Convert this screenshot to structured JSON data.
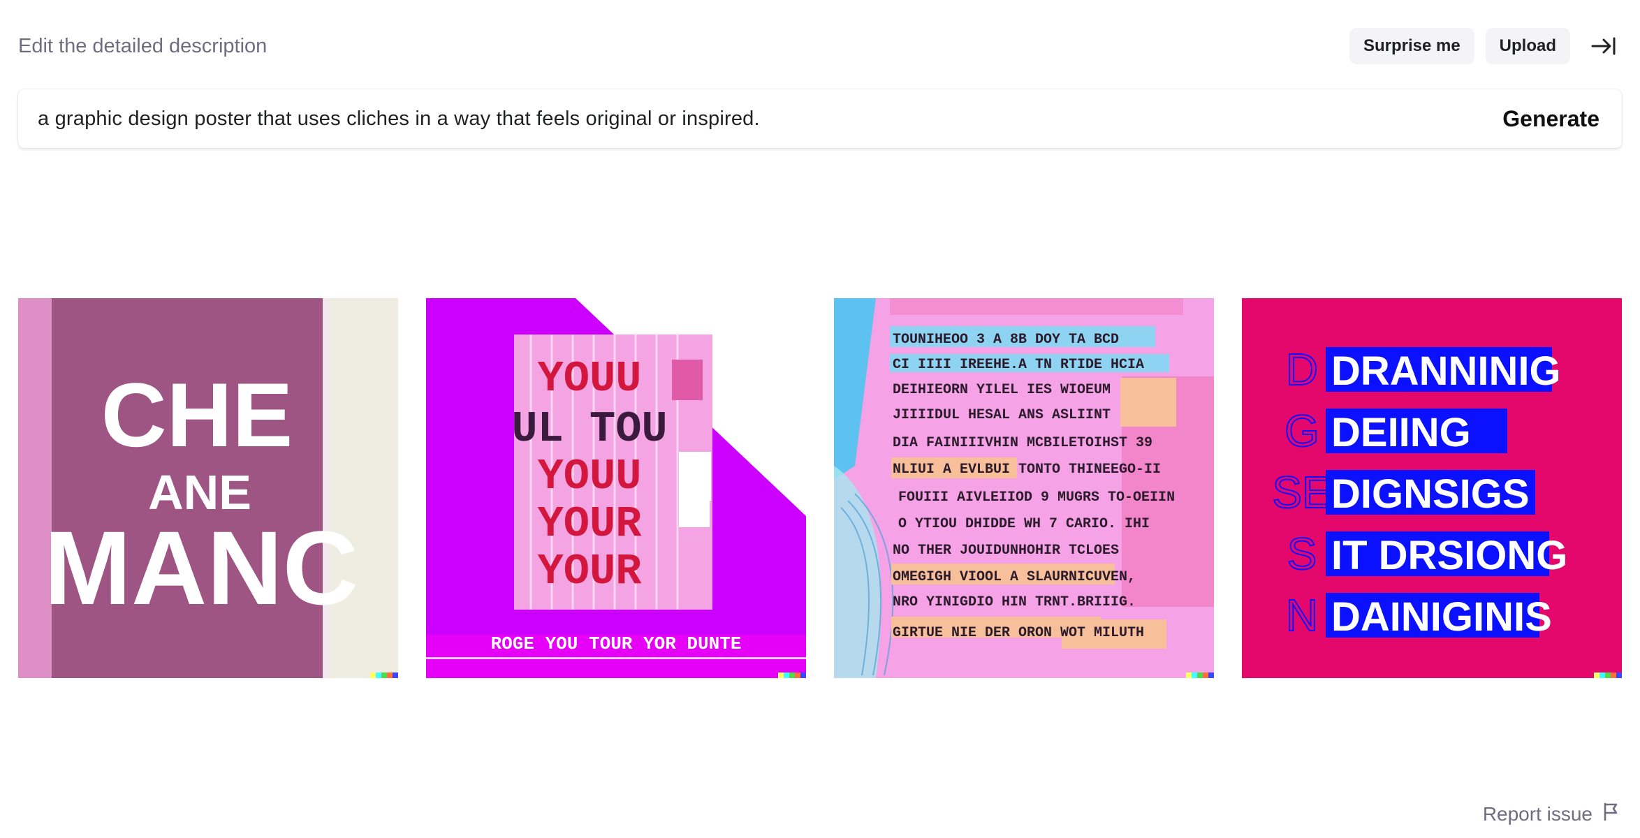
{
  "header": {
    "hint": "Edit the detailed description",
    "surprise_label": "Surprise me",
    "upload_label": "Upload",
    "collapse_icon": "arrow-right-to-line-icon"
  },
  "prompt": {
    "text": "a graphic design poster that uses cliches in a way that feels original or inspired.",
    "generate_label": "Generate"
  },
  "results": [
    {
      "lines": [
        "CHE",
        "ANE",
        "MANC"
      ],
      "palette": [
        "#dd8fc6",
        "#9e5584",
        "#efece2"
      ]
    },
    {
      "lines": [
        "YOUU",
        "UL TOU",
        "YOUU",
        "YOUR",
        "YOUR"
      ],
      "caption": "ROGE YOU TOUR YOR DUNTE",
      "palette": [
        "#cc00ff",
        "#f4a3e3",
        "#d3163e"
      ]
    },
    {
      "lines": [
        "TOUNIHEOO 3 A 8B DOY TA BCD",
        "CI IIII IREEHE.A TN RTIDE HCIA",
        "DEIHIEORN YILEL IES WIOEUM",
        "JIIIIDUL HESAL ANS ASLIINT",
        "DIA FAINIIIVHIN MCBILETOIHST 39",
        "NLIUI A EVLBUI TONTO THINEEGO-II",
        "FOUIII AIVLEIIOD 9 MUGRS TO-OEIIN",
        "O YTIOU DHIDDE WH 7 CARIO. IHI",
        "NO THER JOUIDUNHOHIR TCLOES",
        "OMEGIGH VIOOL A SLAURNICUVEN,",
        "NRO YINIGDIO HIN TRNT.BRIIIG.",
        "GIRTUE NIE DER ORON WOT MILUTH"
      ],
      "palette": [
        "#f5a3e6",
        "#8fd3f2",
        "#f7bf9a"
      ]
    },
    {
      "side": [
        "D",
        "G",
        "SE",
        "S",
        "N"
      ],
      "lines": [
        "DRANNINIG",
        "DEIING",
        "DIGNSIGS",
        "IT DRSIONG",
        "DAINIGINIS"
      ],
      "palette": [
        "#e5086c",
        "#0b10ff",
        "#ffffff"
      ]
    }
  ],
  "footer": {
    "report_label": "Report issue",
    "report_icon": "flag-icon"
  }
}
